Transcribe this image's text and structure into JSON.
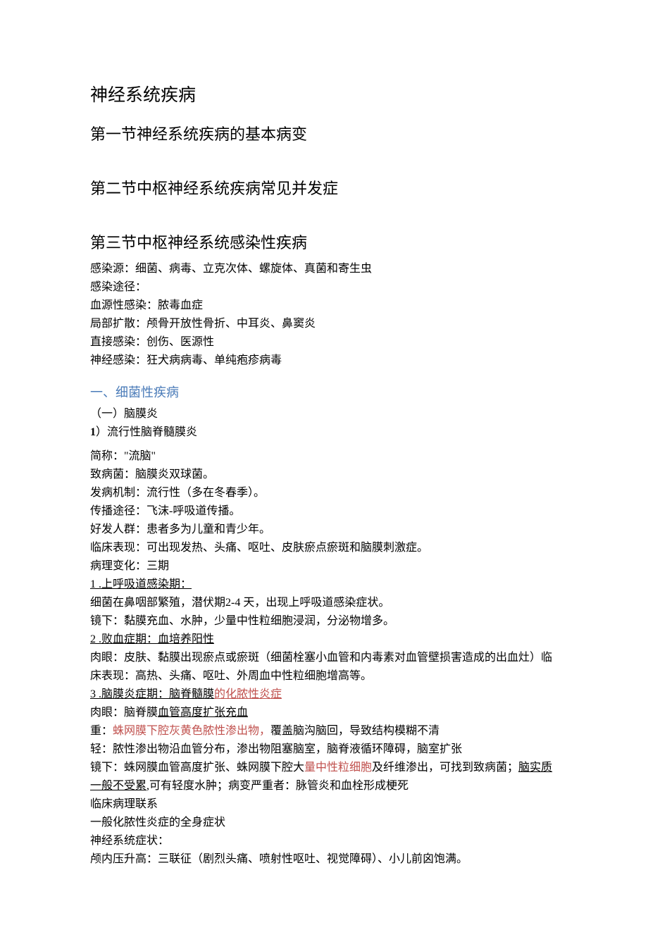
{
  "title": "神经系统疾病",
  "section1": "第一节神经系统疾病的基本病变",
  "section2": "第二节中枢神经系统疾病常见并发症",
  "section3": "第三节中枢神经系统感染性疾病",
  "intro": {
    "source": "感染源：细菌、病毒、立克次体、螺旋体、真菌和寄生虫",
    "routes_label": "感染途径：",
    "r1": "血源性感染：脓毒血症",
    "r2": "局部扩散：颅骨开放性骨折、中耳炎、鼻窦炎",
    "r3": "直接感染：创伤、医源性",
    "r4": "神经感染：狂犬病病毒、单纯疱疹病毒"
  },
  "bacterial_header": "一、细菌性疾病",
  "meningitis_header": "（一）脑膜炎",
  "item1_num": "1",
  "item1_title": "）流行性脑脊髓膜炎",
  "d": {
    "alias": "简称：\"流脑\"",
    "pathogen": "致病菌：脑膜炎双球菌。",
    "mechanism": "发病机制：流行性（多在冬春季）。",
    "route": "传播途径：飞沫-呼吸道传播。",
    "population": "好发人群：患者多为儿童和青少年。",
    "clinical": "临床表现：可出现发热、头痛、呕吐、皮肤瘀点瘀斑和脑膜刺激症。",
    "pathology": "病理变化：三期"
  },
  "p1_num": "1",
  "p1_title": " .上呼吸道感染期：",
  "p1_a": "细菌在鼻咽部繁殖，潜伏期2-4 天，出现上呼吸道感染症状。",
  "p1_b": "镜下：黏膜充血、水肿，少量中性粒细胞浸润，分泌物增多。",
  "p2_num": "2",
  "p2_title": " .败血症期：血培养阳性",
  "p2_a": "肉眼：皮肤、黏膜出现瘀点或瘀斑（细菌栓塞小血管和内毒素对血管壁损害造成的出血灶）临床表现：高热、头痛、呕吐、外周血中性粒细胞增高等。",
  "p3_num": "3",
  "p3_title_a": " .脑膜炎症期：脑脊髓膜",
  "p3_title_b": "的化脓性炎症",
  "p3_a_pre": "肉眼：脑脊膜",
  "p3_a_ul": "血管高度扩张充血",
  "p3_b_pre": "重：",
  "p3_b_red": "蛛网膜下腔灰黄色脓性渗出物，",
  "p3_b_post": "覆盖脑沟脑回，导致结构模糊不清",
  "p3_c": "轻：脓性渗出物沿血管分布，渗出物阻塞脑室，脑脊液循环障碍，脑室扩张",
  "p3_d_pre": "镜下：蛛网膜血管高度扩张、蛛网膜下腔大",
  "p3_d_red": "量中性粒细胞",
  "p3_d_mid": "及纤维渗出，可找到致病菌；",
  "p3_d_ul": "脑实质一般不受累",
  "p3_d_post": ",可有轻度水肿；病变严重者：脉管炎和血栓形成梗死",
  "cl1": "临床病理联系",
  "cl2": "一般化脓性炎症的全身症状",
  "cl3": "神经系统症状：",
  "cl4": "颅内压升高：三联征（剧烈头痛、喷射性呕吐、视觉障碍）、小儿前囟饱满。"
}
